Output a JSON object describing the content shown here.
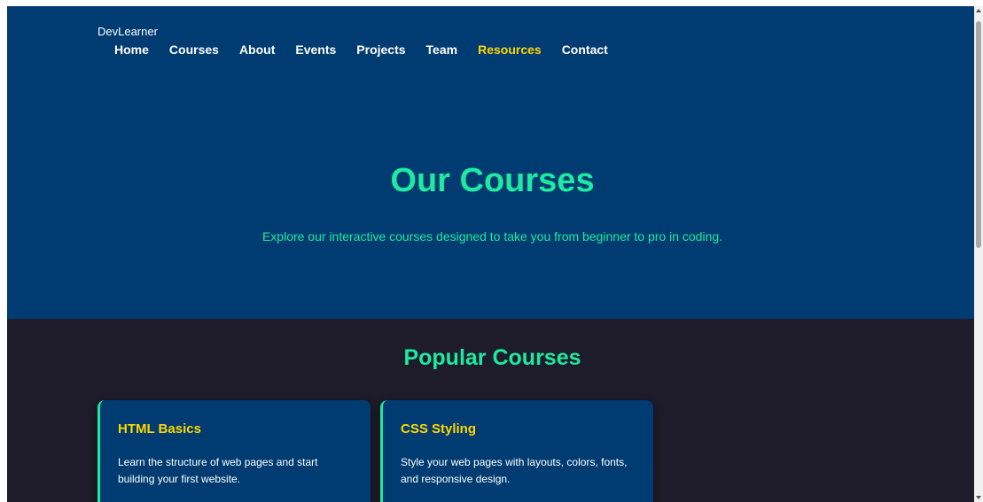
{
  "brand": "DevLearner",
  "nav": {
    "items": [
      {
        "label": "Home"
      },
      {
        "label": "Courses"
      },
      {
        "label": "About"
      },
      {
        "label": "Events"
      },
      {
        "label": "Projects"
      },
      {
        "label": "Team"
      },
      {
        "label": "Resources",
        "active": true
      },
      {
        "label": "Contact"
      }
    ]
  },
  "hero": {
    "title": "Our Courses",
    "subtitle": "Explore our interactive courses designed to take you from beginner to pro in coding."
  },
  "popular": {
    "title": "Popular Courses",
    "courses": [
      {
        "title": "HTML Basics",
        "description": "Learn the structure of web pages and start building your first website."
      },
      {
        "title": "CSS Styling",
        "description": "Style your web pages with layouts, colors, fonts, and responsive design."
      }
    ]
  },
  "colors": {
    "header_bg": "#003c71",
    "section_bg": "#1e1b2a",
    "accent_green": "#1de9a0",
    "accent_yellow": "#ffd700"
  }
}
